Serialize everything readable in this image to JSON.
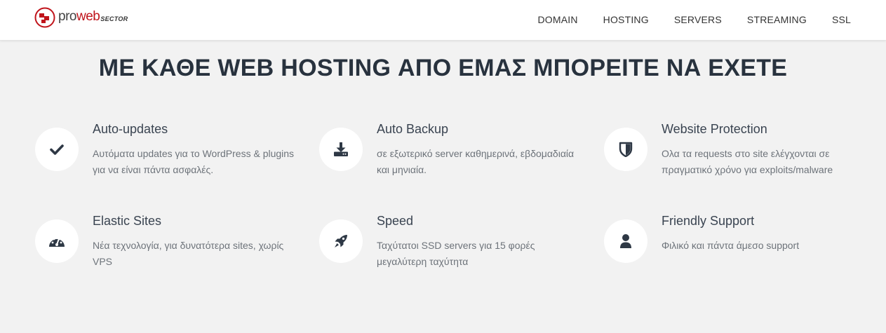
{
  "header": {
    "logo": {
      "pro": "pro",
      "web": "web",
      "sector": "SECTOR"
    },
    "nav": [
      "DOMAIN",
      "HOSTING",
      "SERVERS",
      "STREAMING",
      "SSL"
    ]
  },
  "headline": "ΜΕ ΚΑΘΕ WEB HOSTING ΑΠΟ ΕΜΑΣ ΜΠΟΡΕΙΤΕ ΝΑ ΕΧΕΤΕ",
  "features": [
    {
      "title": "Auto-updates",
      "description": "Αυτόματα updates για το WordPress & plugins για να είναι πάντα ασφαλές.",
      "icon": "check-icon"
    },
    {
      "title": "Auto Backup",
      "description": "σε εξωτερικό server καθημερινά, εβδομαδιαία και μηνιαία.",
      "icon": "download-icon"
    },
    {
      "title": "Website Protection",
      "description": "Ολα τα requests στο site ελέγχονται σε πραγματικό χρόνο για exploits/malware",
      "icon": "shield-icon"
    },
    {
      "title": "Elastic Sites",
      "description": "Νέα τεχνολογία, για δυνατότερα sites, χωρίς VPS",
      "icon": "speedometer-icon"
    },
    {
      "title": "Speed",
      "description": "Ταχύτατοι SSD servers για 15 φορές μεγαλύτερη ταχύτητα",
      "icon": "rocket-icon"
    },
    {
      "title": "Friendly Support",
      "description": "Φιλικό και πάντα άμεσο support",
      "icon": "user-icon"
    }
  ],
  "colors": {
    "brand_red": "#c0141b",
    "icon_dark": "#2e3845",
    "background": "#f2f2f2"
  }
}
